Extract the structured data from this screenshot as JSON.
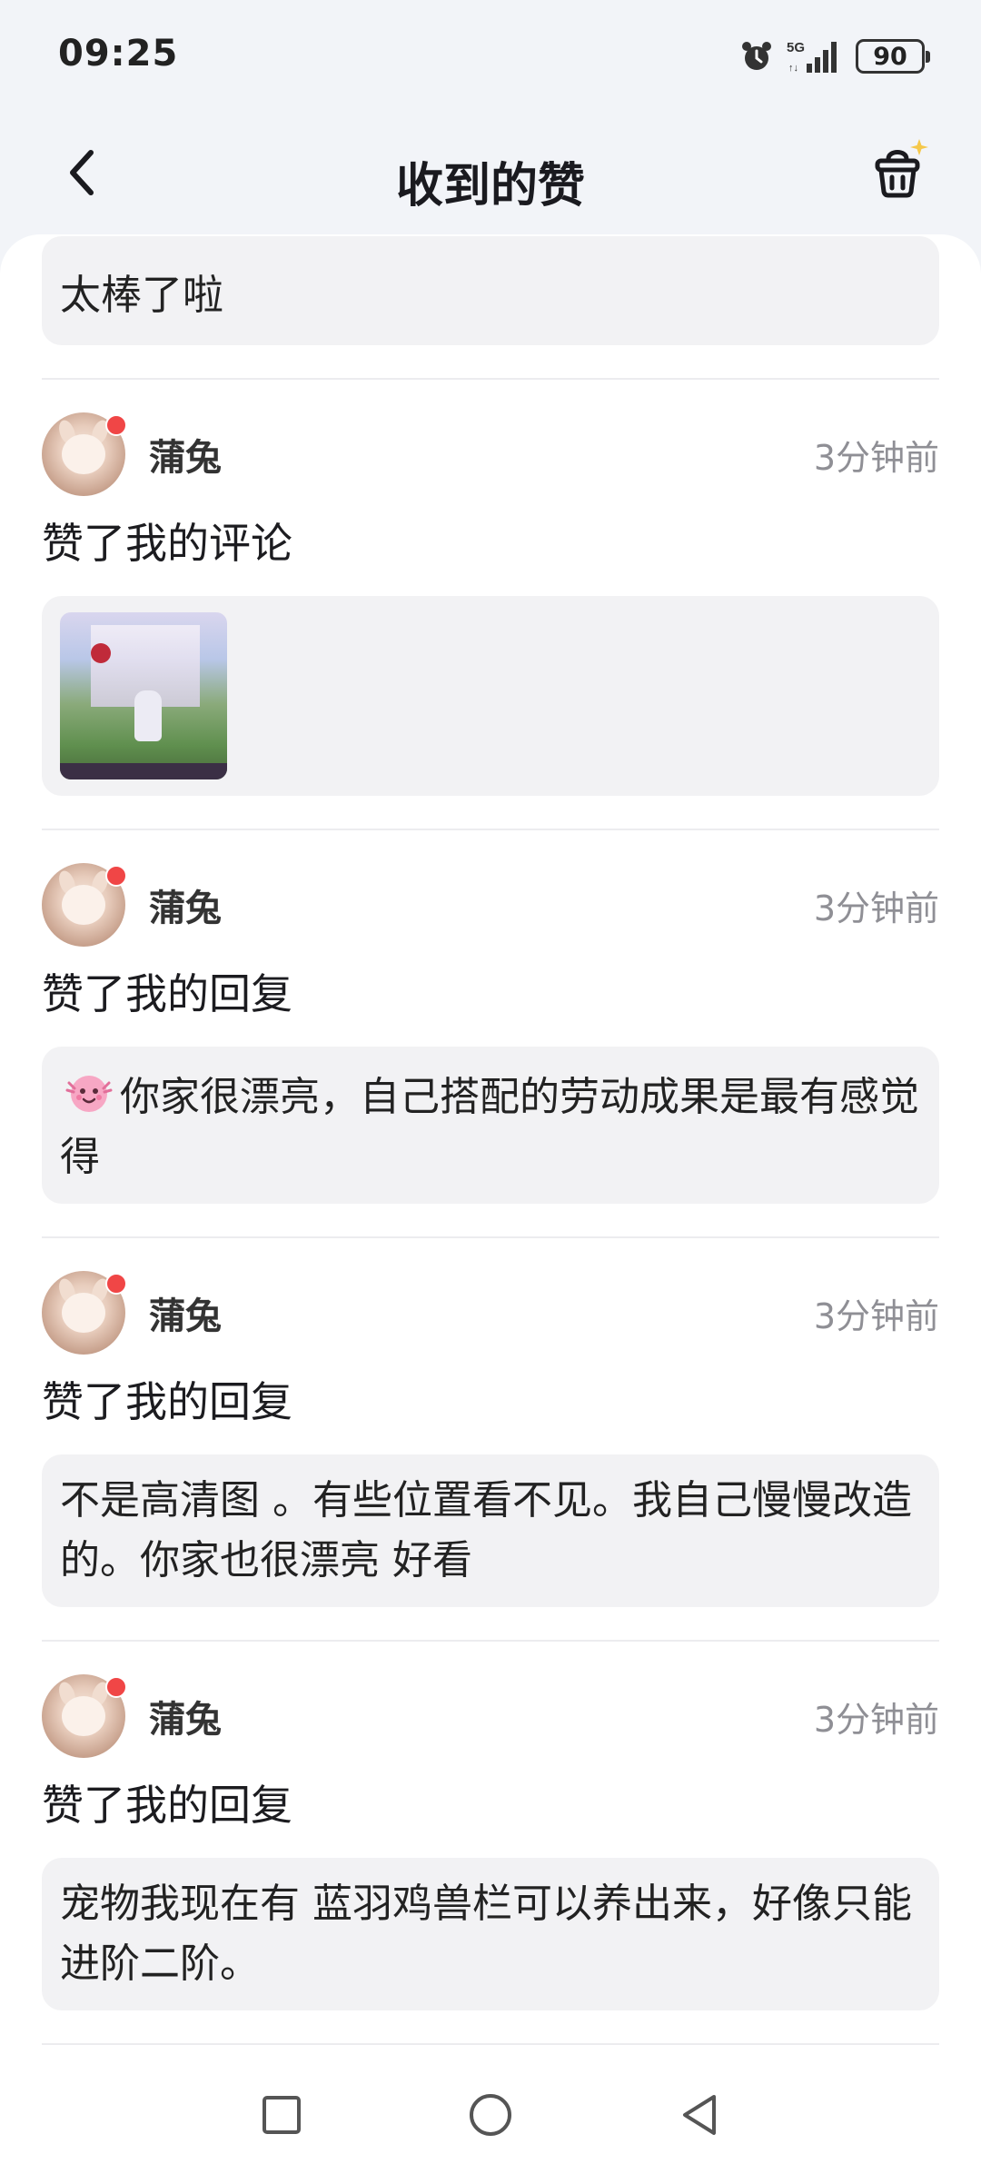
{
  "status_bar": {
    "time": "09:25",
    "network": "5G",
    "battery": "90",
    "icons": [
      "alarm-icon",
      "signal-icon",
      "battery-icon"
    ]
  },
  "header": {
    "title": "收到的赞",
    "back_icon": "chevron-left-icon",
    "right_icon": "basket-sparkle-icon"
  },
  "top_snippet": "太棒了啦",
  "notifications": [
    {
      "username": "蒲兔",
      "time": "3分钟前",
      "action": "赞了我的评论",
      "type": "image"
    },
    {
      "username": "蒲兔",
      "time": "3分钟前",
      "action": "赞了我的回复",
      "type": "text",
      "content": "你家很漂亮，自己搭配的劳动成果是最有感觉得",
      "has_emoji": true
    },
    {
      "username": "蒲兔",
      "time": "3分钟前",
      "action": "赞了我的回复",
      "type": "text",
      "content": "不是高清图 。有些位置看不见。我自己慢慢改造的。你家也很漂亮 好看"
    },
    {
      "username": "蒲兔",
      "time": "3分钟前",
      "action": "赞了我的回复",
      "type": "text",
      "content": "宠物我现在有 蓝羽鸡兽栏可以养出来，好像只能进阶二阶。"
    }
  ],
  "nav_bar": {
    "buttons": [
      "recents-square-icon",
      "home-circle-icon",
      "back-triangle-icon"
    ]
  },
  "colors": {
    "background": "#f2f4f8",
    "card": "#ffffff",
    "bubble": "#f2f2f4",
    "unread_dot": "#f04646",
    "secondary_text": "#8f8f95"
  }
}
